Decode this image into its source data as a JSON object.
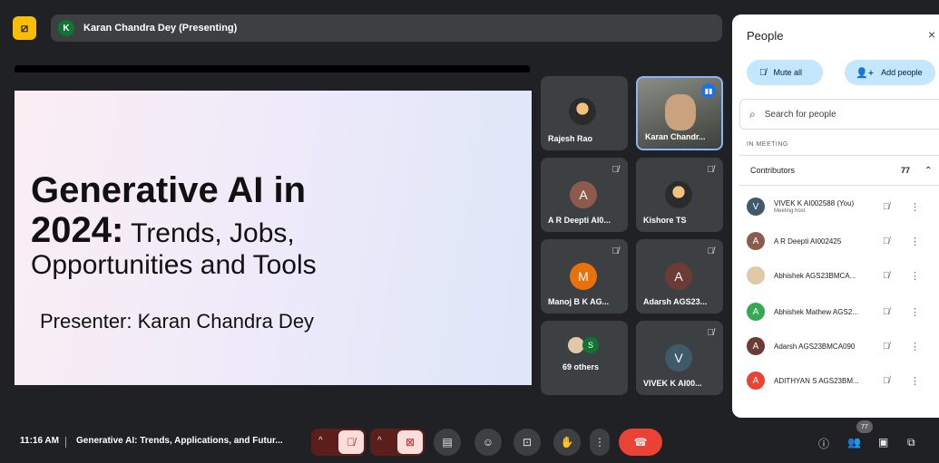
{
  "top_bar": {
    "presenter_initial": "K",
    "presenter_label": "Karan Chandra Dey (Presenting)"
  },
  "slide": {
    "title_line1": "Generative AI in",
    "title_line2_bold": "2024:",
    "title_line2_rest": " Trends, Jobs,",
    "title_line3": "Opportunities and Tools",
    "presenter": "Presenter: Karan Chandra Dey"
  },
  "tiles": [
    {
      "name": "Rajesh Rao",
      "initial": "",
      "color": ""
    },
    {
      "name": "Karan Chandr...",
      "initial": "",
      "color": ""
    },
    {
      "name": "A R Deepti AI0...",
      "initial": "A",
      "color": "#8d5b4c"
    },
    {
      "name": "Kishore TS",
      "initial": "",
      "color": ""
    },
    {
      "name": "Manoj B K AG...",
      "initial": "M",
      "color": "#e8710a"
    },
    {
      "name": "Adarsh AGS23...",
      "initial": "A",
      "color": "#6d3b35"
    },
    {
      "name": "69 others",
      "initial": "S",
      "color": "#137333"
    },
    {
      "name": "VIVEK K AI00...",
      "initial": "V",
      "color": "#3f5a6b"
    }
  ],
  "panel": {
    "title": "People",
    "close_icon": "×",
    "mute_all": "Mute all",
    "add_people": "Add people",
    "search_placeholder": "Search for people",
    "in_meeting": "IN MEETING",
    "contributors_label": "Contributors",
    "contributors_count": "77",
    "people": [
      {
        "initial": "V",
        "color": "#3f5a6b",
        "name": "VIVEK K AI002588 (You)",
        "sub": "Meeting host"
      },
      {
        "initial": "A",
        "color": "#8d5b4c",
        "name": "A R Deepti AI002425",
        "sub": ""
      },
      {
        "initial": "",
        "color": "#e0c9a6",
        "name": "Abhishek AGS23BMCA...",
        "sub": ""
      },
      {
        "initial": "A",
        "color": "#34a853",
        "name": "Abhishek Mathew AGS2...",
        "sub": ""
      },
      {
        "initial": "A",
        "color": "#6d3b35",
        "name": "Adarsh AGS23BMCA090",
        "sub": ""
      },
      {
        "initial": "A",
        "color": "#ea4335",
        "name": "ADITHYAN S AGS23BM...",
        "sub": ""
      }
    ]
  },
  "bottom_bar": {
    "time": "11:16 AM",
    "meeting_title": "Generative AI: Trends, Applications, and Futur...",
    "people_count": "77"
  }
}
